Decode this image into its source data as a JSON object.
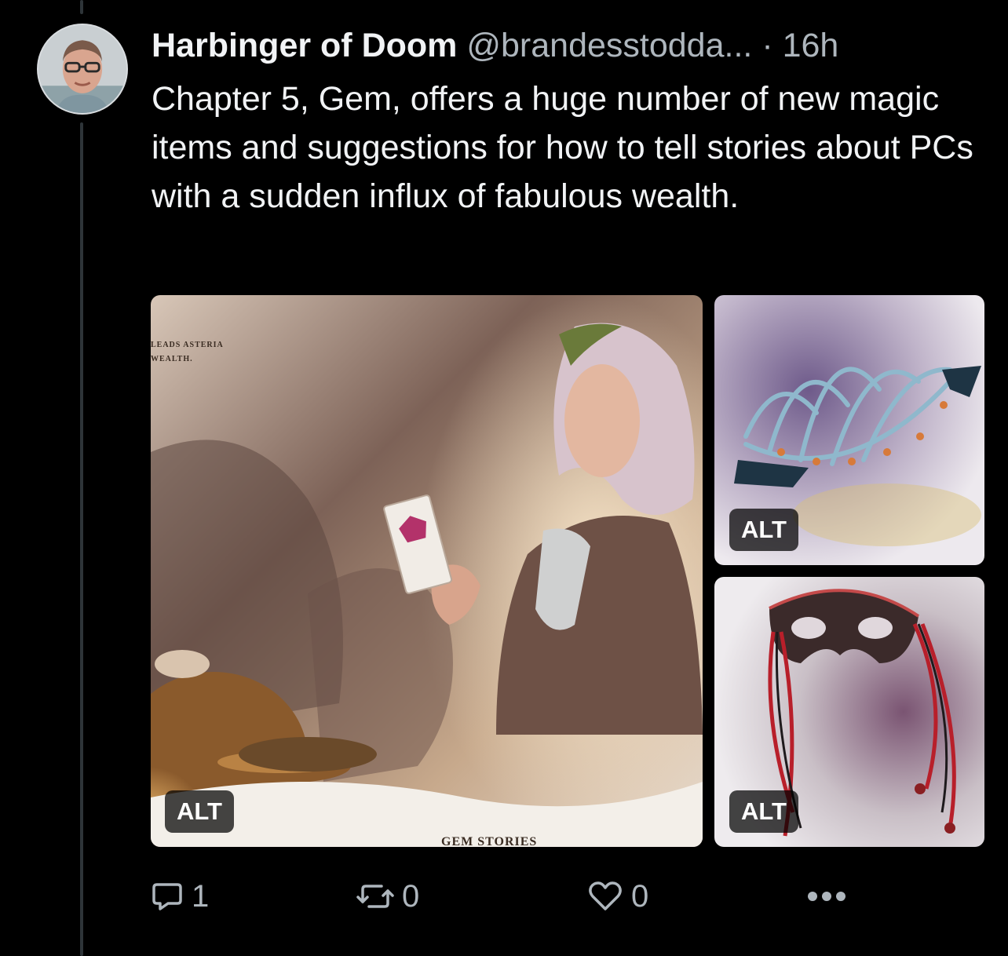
{
  "post": {
    "author": {
      "display_name": "Harbinger of Doom",
      "handle": "@brandesstodda...",
      "avatar_icon": "avatar-photo"
    },
    "separator": "·",
    "timestamp": "16h",
    "text": "Chapter 5, Gem, offers a huge number of new magic items and suggestions for how to tell stories about PCs with a sudden influx of fabulous wealth.",
    "media": [
      {
        "alt_label": "ALT",
        "page_tag_line1": "LEADS ASTERIA",
        "page_tag_line2": "WEALTH.",
        "caption": "GEM STORIES"
      },
      {
        "alt_label": "ALT"
      },
      {
        "alt_label": "ALT"
      }
    ],
    "actions": {
      "reply": {
        "icon": "reply-bubble-icon",
        "count": "1"
      },
      "repost": {
        "icon": "repost-icon",
        "count": "0"
      },
      "like": {
        "icon": "heart-icon",
        "count": "0"
      },
      "more": {
        "icon": "more-dots-icon"
      }
    }
  },
  "colors": {
    "background": "#000000",
    "text": "#f1f3f5",
    "muted": "#aeb6bd",
    "thread_line": "#2e3438"
  }
}
